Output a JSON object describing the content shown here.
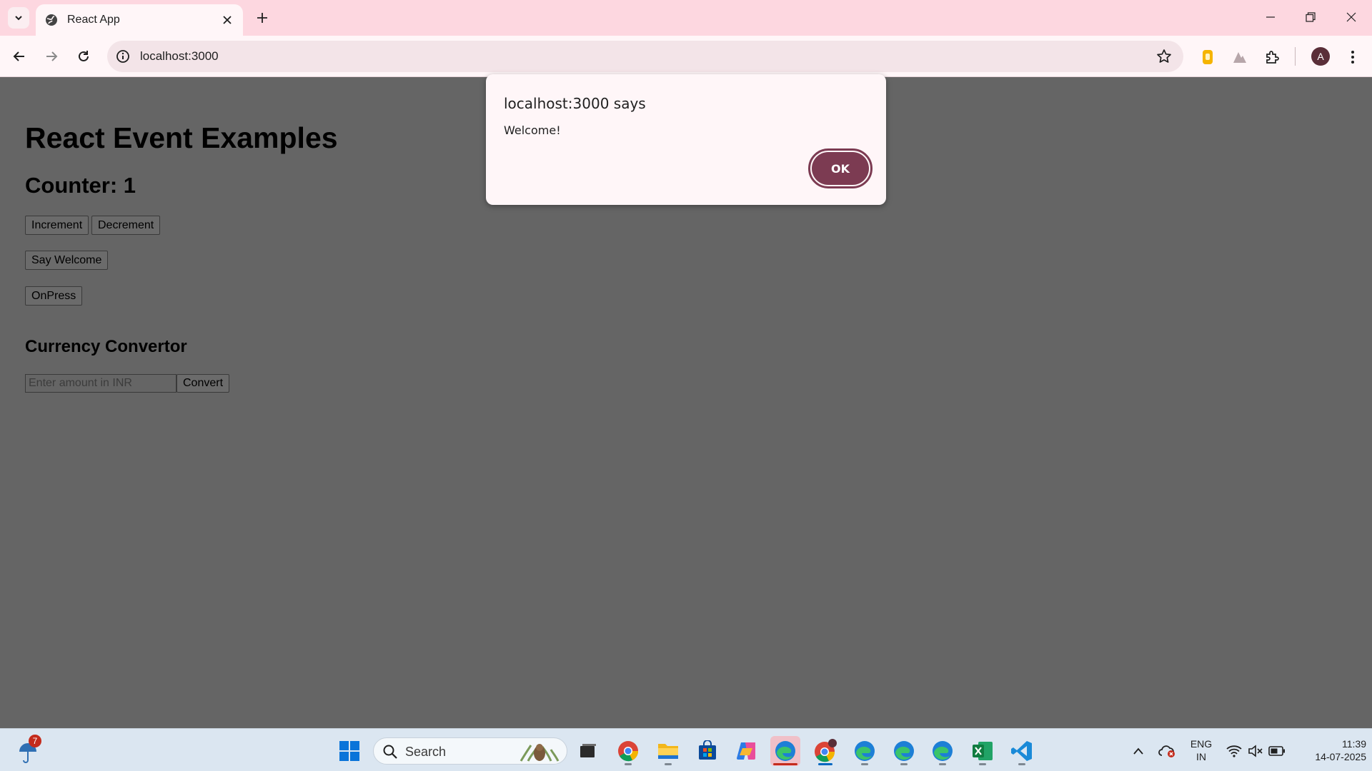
{
  "browser": {
    "tab_title": "React App",
    "url": "localhost:3000",
    "profile_initial": "A",
    "accent": "#fdd7e0"
  },
  "page": {
    "heading": "React Event Examples",
    "counter_label": "Counter: 1",
    "buttons": {
      "increment": "Increment",
      "decrement": "Decrement",
      "say_welcome": "Say Welcome",
      "onpress": "OnPress",
      "convert": "Convert"
    },
    "currency_heading": "Currency Convertor",
    "amount_input": {
      "value": "",
      "placeholder": "Enter amount in INR"
    }
  },
  "dialog": {
    "title": "localhost:3000 says",
    "message": "Welcome!",
    "ok_label": "OK",
    "accent": "#7c3b52"
  },
  "taskbar": {
    "weather_badge": "7",
    "search_placeholder": "Search",
    "language_top": "ENG",
    "language_bottom": "IN",
    "time": "11:39",
    "date": "14-07-2025"
  }
}
